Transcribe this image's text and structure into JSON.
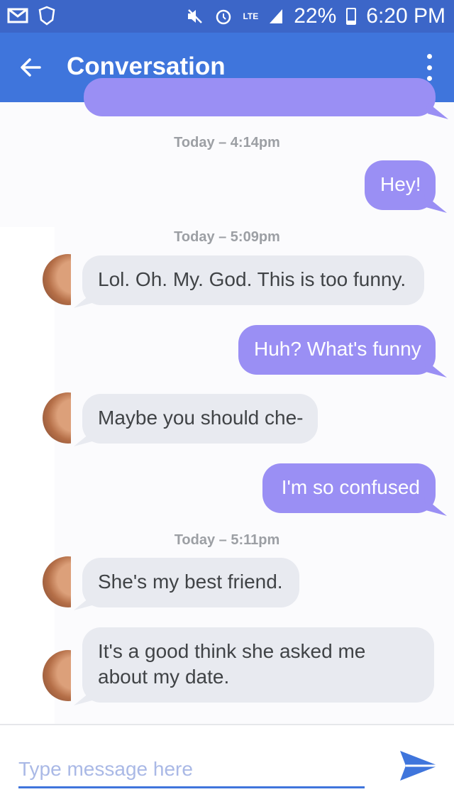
{
  "status_bar": {
    "left_icons": [
      "mail-icon",
      "nhl-icon"
    ],
    "right_icons": [
      "mute-icon",
      "alarm-icon",
      "signal-icon"
    ],
    "network": "LTE",
    "battery_percent": "22%",
    "battery_level": 0.22,
    "time": "6:20 PM"
  },
  "app_bar": {
    "title": "Conversation",
    "back_icon": "arrow-back-icon",
    "menu_icon": "more-vert-icon"
  },
  "messages": [
    {
      "type": "timestamp",
      "text": "Today – 4:14pm"
    },
    {
      "type": "outgoing",
      "text": "Hey!"
    },
    {
      "type": "timestamp",
      "text": "Today – 5:09pm"
    },
    {
      "type": "incoming",
      "text": "Lol. Oh. My. God. This is too funny."
    },
    {
      "type": "outgoing",
      "text": "Huh? What's funny"
    },
    {
      "type": "incoming",
      "text": "Maybe you should che-"
    },
    {
      "type": "outgoing",
      "text": "I'm so confused"
    },
    {
      "type": "timestamp",
      "text": "Today – 5:11pm"
    },
    {
      "type": "incoming",
      "text": "She's my best friend."
    },
    {
      "type": "incoming",
      "text": "It's a good think she asked me about my date."
    }
  ],
  "composer": {
    "placeholder": "Type message here",
    "value": "",
    "send_icon": "send-icon"
  },
  "colors": {
    "status_bar": "#3c66c8",
    "app_bar": "#3f75dc",
    "outgoing_bubble": "#9a8ff4",
    "incoming_bubble": "#e8eaf0",
    "timestamp": "#9c9fa4"
  }
}
